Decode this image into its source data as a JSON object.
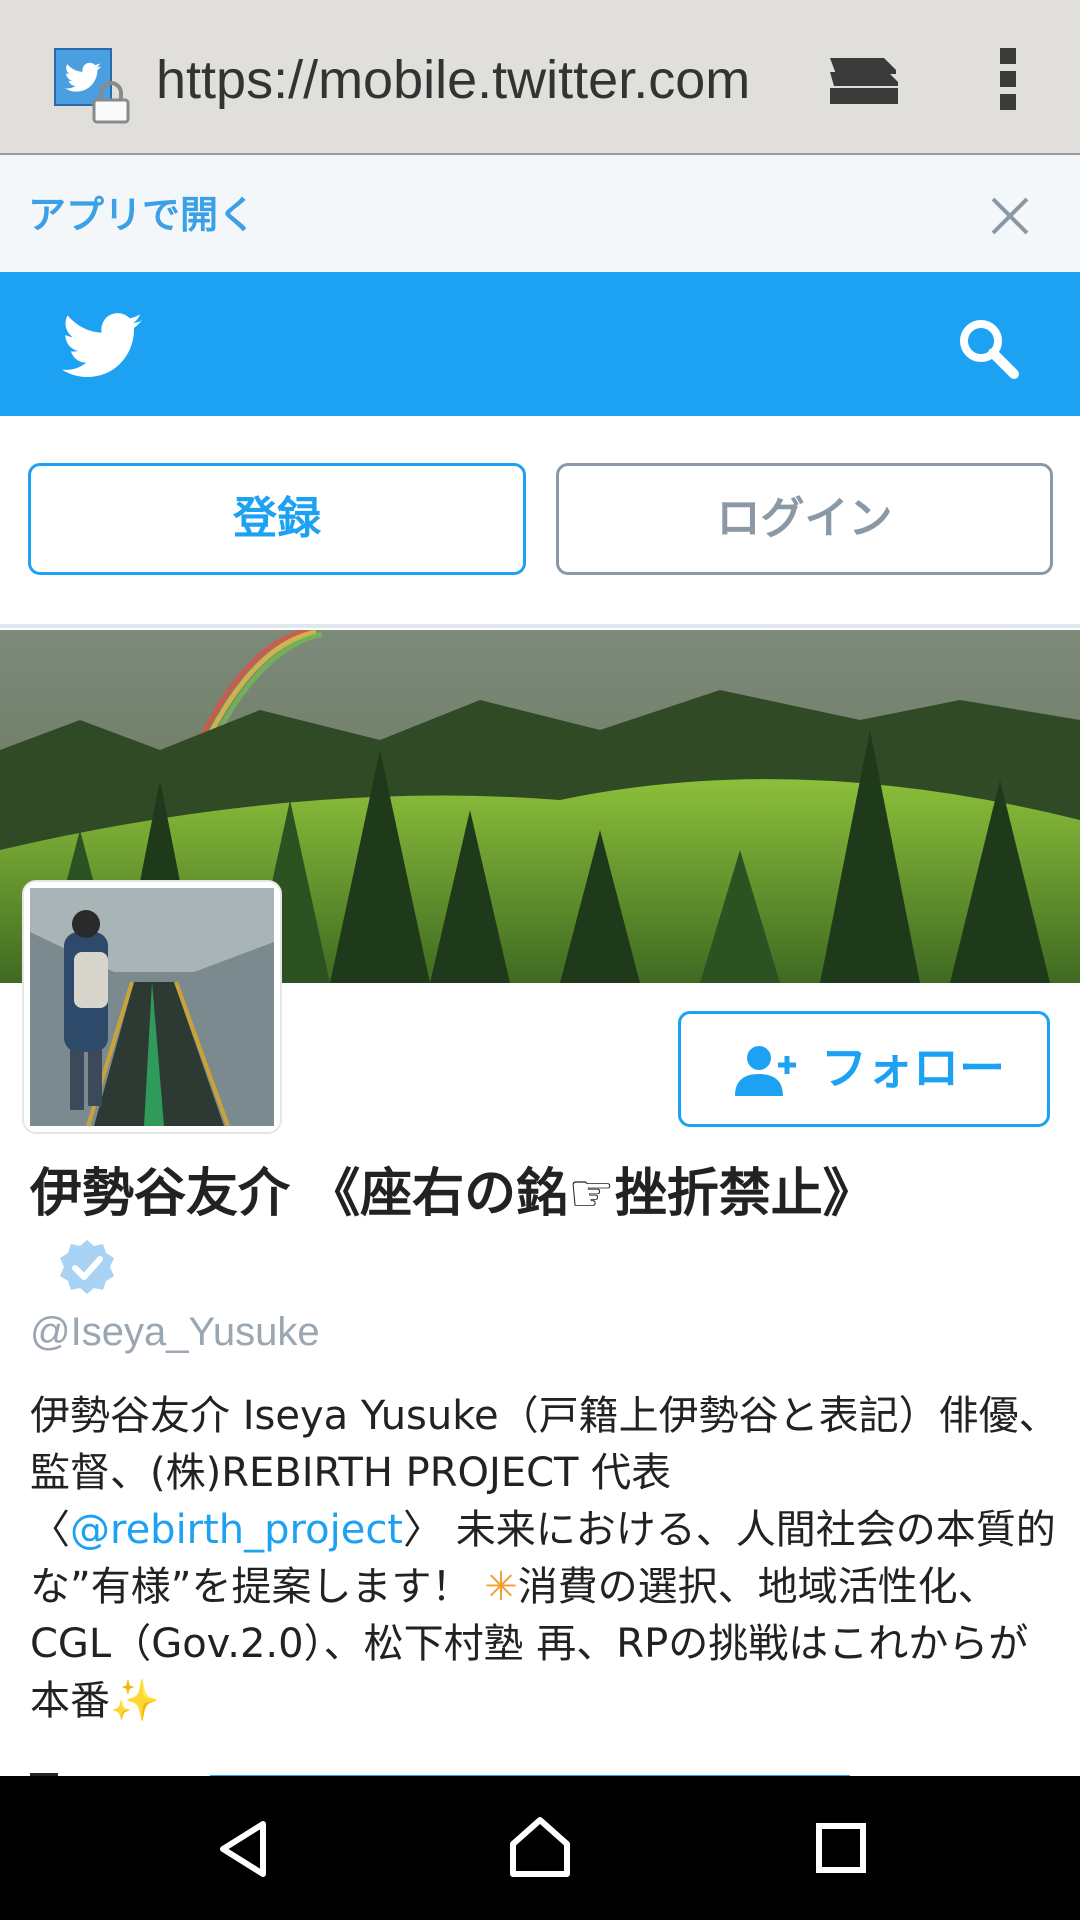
{
  "browser": {
    "url": "https://mobile.twitter.com",
    "favicon_icon": "twitter-favicon-icon",
    "lock_icon": "lock-icon",
    "tabs_icon": "tabs-icon",
    "menu_icon": "more-vert-icon"
  },
  "app_banner": {
    "open_in_app": "アプリで開く",
    "close_icon": "close-icon"
  },
  "header": {
    "logo_icon": "twitter-bird-icon",
    "search_icon": "search-icon",
    "bg_color": "#1da1f2"
  },
  "auth": {
    "signup_label": "登録",
    "login_label": "ログイン"
  },
  "profile": {
    "display_name": "伊勢谷友介 《座右の銘☞挫折禁止》",
    "verified_icon": "verified-badge-icon",
    "handle": "@Iseya_Yusuke",
    "follow_label": "フォロー",
    "follow_icon": "add-user-icon",
    "bio": {
      "part1": "伊勢谷友介 Iseya Yusuke（戸籍上伊勢谷と表記）俳優、監督、(株)REBIRTH PROJECT 代表〈",
      "mention": "@rebirth_project",
      "part2": "〉 未来における、人間社会の本質的な”有様”を提案します！ ",
      "sparkle1": "✳",
      "part3": "消費の選択、地域活性化、CGL（Gov.2.0）、松下村塾 再、RPの挑戦はこれからが本番",
      "sparkle2": "✨"
    }
  },
  "nav": {
    "back_icon": "back-triangle-icon",
    "home_icon": "home-icon",
    "recent_icon": "recent-apps-icon"
  }
}
